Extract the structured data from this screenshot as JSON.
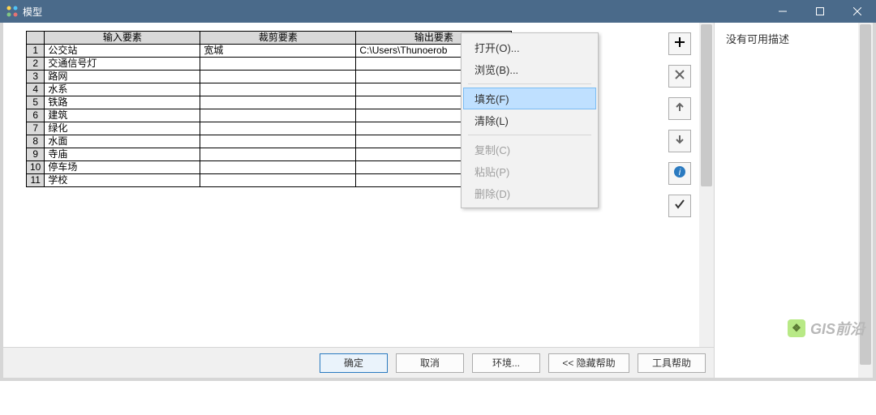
{
  "window": {
    "title": "模型"
  },
  "table": {
    "headers": [
      "输入要素",
      "裁剪要素",
      "输出要素"
    ],
    "rows": [
      {
        "n": "1",
        "a": "公交站",
        "b": "宽城",
        "c": "C:\\Users\\Thunoerob"
      },
      {
        "n": "2",
        "a": "交通信号灯",
        "b": "",
        "c": ""
      },
      {
        "n": "3",
        "a": "路网",
        "b": "",
        "c": ""
      },
      {
        "n": "4",
        "a": "水系",
        "b": "",
        "c": ""
      },
      {
        "n": "5",
        "a": "铁路",
        "b": "",
        "c": ""
      },
      {
        "n": "6",
        "a": "建筑",
        "b": "",
        "c": ""
      },
      {
        "n": "7",
        "a": "绿化",
        "b": "",
        "c": ""
      },
      {
        "n": "8",
        "a": "水面",
        "b": "",
        "c": ""
      },
      {
        "n": "9",
        "a": "寺庙",
        "b": "",
        "c": ""
      },
      {
        "n": "10",
        "a": "停车场",
        "b": "",
        "c": ""
      },
      {
        "n": "11",
        "a": "学校",
        "b": "",
        "c": ""
      }
    ]
  },
  "context_menu": {
    "open": "打开(O)...",
    "browse": "浏览(B)...",
    "fill": "填充(F)",
    "clear": "清除(L)",
    "copy": "复制(C)",
    "paste": "粘贴(P)",
    "delete": "删除(D)"
  },
  "help_pane": {
    "empty": "没有可用描述"
  },
  "footer": {
    "ok": "确定",
    "cancel": "取消",
    "env": "环境...",
    "hide_help": "<< 隐藏帮助",
    "tool_help": "工具帮助"
  },
  "watermark": {
    "text": "GIS前沿"
  }
}
